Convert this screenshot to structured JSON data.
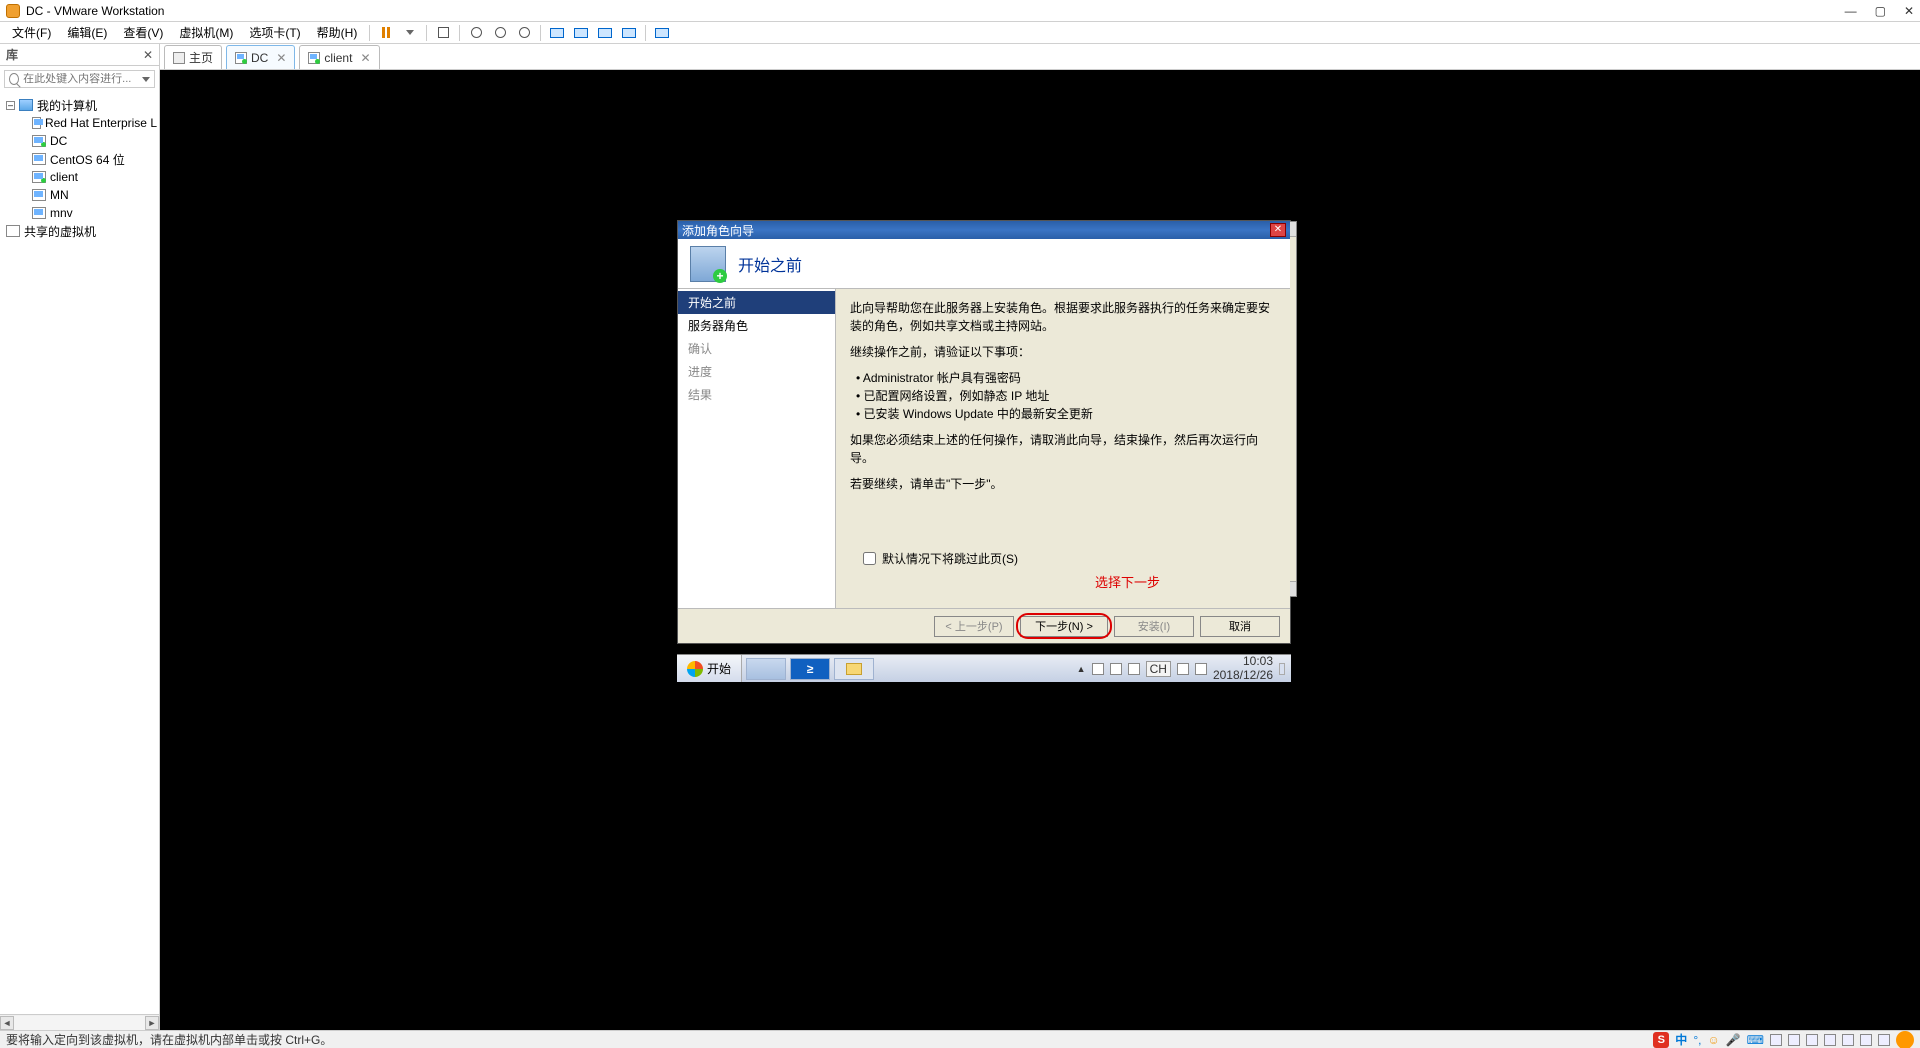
{
  "host": {
    "title": "DC - VMware Workstation",
    "window_buttons": {
      "min": "—",
      "max": "▢",
      "close": "✕"
    }
  },
  "menu": {
    "items": [
      "文件(F)",
      "编辑(E)",
      "查看(V)",
      "虚拟机(M)",
      "选项卡(T)",
      "帮助(H)"
    ]
  },
  "sidebar": {
    "title": "库",
    "search_placeholder": "在此处键入内容进行...",
    "root": "我的计算机",
    "vms": [
      "Red Hat Enterprise L",
      "DC",
      "CentOS 64 位",
      "client",
      "MN",
      "mnv"
    ],
    "shared": "共享的虚拟机"
  },
  "tabs": {
    "items": [
      {
        "label": "主页",
        "type": "home"
      },
      {
        "label": "DC",
        "type": "vm-on",
        "active": true
      },
      {
        "label": "client",
        "type": "vm-on"
      }
    ]
  },
  "wizard": {
    "title": "添加角色向导",
    "header": "开始之前",
    "nav": [
      {
        "label": "开始之前",
        "state": "selected"
      },
      {
        "label": "服务器角色",
        "state": "enabled"
      },
      {
        "label": "确认",
        "state": "disabled"
      },
      {
        "label": "进度",
        "state": "disabled"
      },
      {
        "label": "结果",
        "state": "disabled"
      }
    ],
    "para1": "此向导帮助您在此服务器上安装角色。根据要求此服务器执行的任务来确定要安装的角色，例如共享文档或主持网站。",
    "para2": "继续操作之前，请验证以下事项：",
    "bullets": [
      "Administrator 帐户具有强密码",
      "已配置网络设置，例如静态 IP 地址",
      "已安装 Windows Update 中的最新安全更新"
    ],
    "para3": "如果您必须结束上述的任何操作，请取消此向导，结束操作，然后再次运行向导。",
    "para4": "若要继续，请单击\"下一步\"。",
    "skip_checkbox": "默认情况下将跳过此页(S)",
    "annotation": "选择下一步",
    "buttons": {
      "prev": "< 上一步(P)",
      "next": "下一步(N) >",
      "install": "安装(I)",
      "cancel": "取消"
    }
  },
  "guest_taskbar": {
    "start": "开始",
    "ime": "CH",
    "time": "10:03",
    "date": "2018/12/26"
  },
  "statusbar": {
    "text": "要将输入定向到该虚拟机，请在虚拟机内部单击或按 Ctrl+G。",
    "ime_s": "S",
    "ime_cn": "中"
  }
}
